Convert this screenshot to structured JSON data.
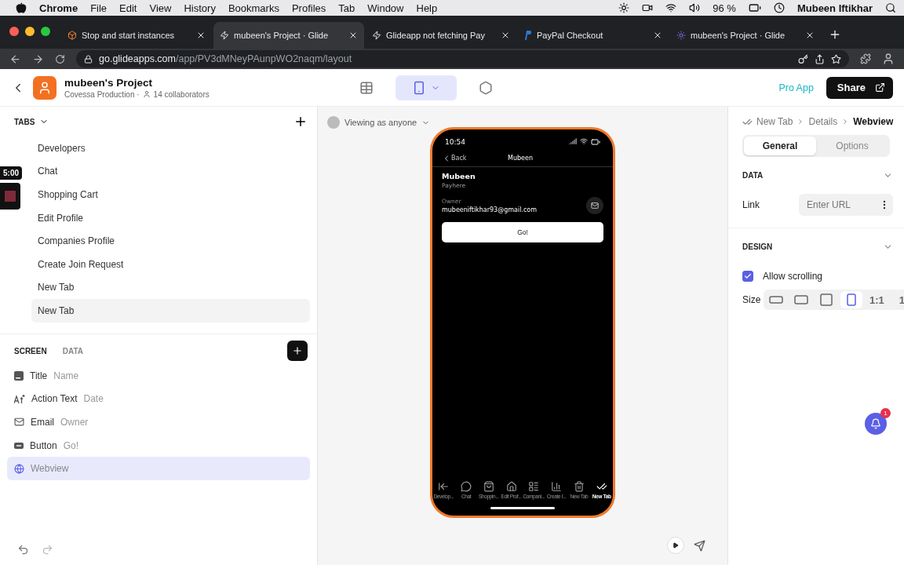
{
  "menu_bar": {
    "app": "Chrome",
    "items": [
      "File",
      "Edit",
      "View",
      "History",
      "Bookmarks",
      "Profiles",
      "Tab",
      "Window",
      "Help"
    ],
    "battery": "96 %",
    "user": "Mubeen Iftikhar"
  },
  "browser_tabs": [
    {
      "title": "Stop and start instances",
      "kind": "aws",
      "selected": false
    },
    {
      "title": "mubeen's Project · Glide",
      "kind": "glide",
      "selected": true
    },
    {
      "title": "Glideapp not fetching Pay",
      "kind": "glide",
      "selected": false
    },
    {
      "title": "PayPal Checkout",
      "kind": "paypal",
      "selected": false
    },
    {
      "title": "mubeen's Project · Glide",
      "kind": "star",
      "selected": false
    }
  ],
  "address_bar": {
    "domain": "go.glideapps.com",
    "path": "/app/PV3dMNeyPAunpWO2naqm/layout"
  },
  "header": {
    "title": "mubeen's Project",
    "team": "Covessa Production ·",
    "collaborators": "14 collaborators",
    "modes": [
      {
        "kind": "data",
        "selected": false
      },
      {
        "kind": "layout",
        "selected": true
      },
      {
        "kind": "settings",
        "selected": false
      }
    ],
    "pro": "Pro App",
    "share": "Share"
  },
  "tabs_panel": {
    "heading": "TABS",
    "items": [
      {
        "label": "Developers",
        "selected": false
      },
      {
        "label": "Chat",
        "selected": false
      },
      {
        "label": "Shopping Cart",
        "selected": false
      },
      {
        "label": "Edit Profile",
        "selected": false
      },
      {
        "label": "Companies Profile",
        "selected": false
      },
      {
        "label": "Create Join Request",
        "selected": false
      },
      {
        "label": "New Tab",
        "selected": false
      },
      {
        "label": "New Tab",
        "selected": true
      }
    ]
  },
  "recorder": {
    "time": "5:00"
  },
  "screen_panel": {
    "tabs": [
      {
        "label": "SCREEN",
        "selected": true
      },
      {
        "label": "DATA",
        "selected": false
      }
    ],
    "components": [
      {
        "kind": "title",
        "label": "Title",
        "value": "Name",
        "selected": false
      },
      {
        "kind": "text",
        "label": "Action Text",
        "value": "Date",
        "selected": false
      },
      {
        "kind": "email",
        "label": "Email",
        "value": "Owner",
        "selected": false
      },
      {
        "kind": "button",
        "label": "Button",
        "value": "Go!",
        "selected": false
      },
      {
        "kind": "webview",
        "label": "Webview",
        "selected": true
      }
    ]
  },
  "preview": {
    "viewing": "Viewing as anyone",
    "phone": {
      "time": "10:54",
      "back": "Back",
      "nav_title": "Mubeen",
      "title": "Mubeen",
      "subtitle": "Payhere",
      "email_label": "Owner",
      "email": "mubeeniftikhar93@gmail.com",
      "button": "Go!",
      "tab_bar": [
        {
          "kind": "back",
          "label": "Develop...",
          "selected": false
        },
        {
          "kind": "chat",
          "label": "Chat",
          "selected": false
        },
        {
          "kind": "bag",
          "label": "Shoppin...",
          "selected": false
        },
        {
          "kind": "home",
          "label": "Edit Prof...",
          "selected": false
        },
        {
          "kind": "list",
          "label": "Compani...",
          "selected": false
        },
        {
          "kind": "chart",
          "label": "Create I...",
          "selected": false
        },
        {
          "kind": "trash",
          "label": "New Tab",
          "selected": false
        },
        {
          "kind": "check",
          "label": "New Tab",
          "selected": true
        }
      ]
    }
  },
  "notifications": {
    "badge": "1"
  },
  "inspector": {
    "breadcrumb": [
      "New Tab",
      "Details",
      "Webview"
    ],
    "segments": [
      {
        "label": "General",
        "selected": true
      },
      {
        "label": "Options",
        "selected": false
      }
    ],
    "data_heading": "DATA",
    "link_label": "Link",
    "link_placeholder": "Enter URL",
    "design_heading": "DESIGN",
    "allow_scrolling": {
      "label": "Allow scrolling",
      "checked": true
    },
    "size_label": "Size",
    "sizes": [
      {
        "kind": "wide",
        "selected": false
      },
      {
        "kind": "medium",
        "selected": false
      },
      {
        "kind": "square",
        "selected": false
      },
      {
        "kind": "tall",
        "selected": true
      },
      {
        "kind": "ratio",
        "label": "1:1",
        "selected": false
      },
      {
        "kind": "ratio",
        "label": "1",
        "selected": false
      }
    ]
  }
}
